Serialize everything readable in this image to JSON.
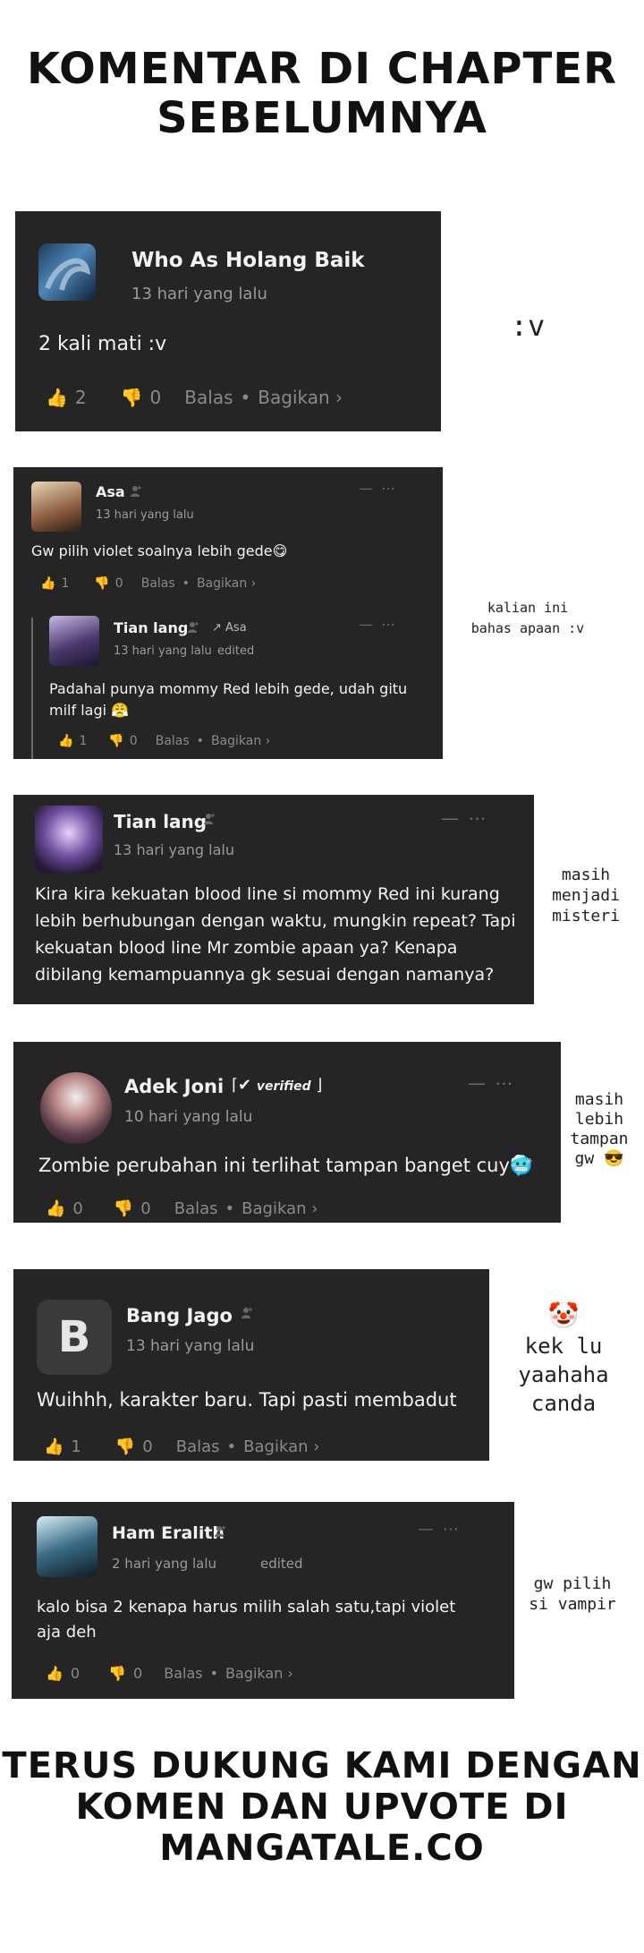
{
  "header": {
    "line1": "KOMENTAR DI CHAPTER",
    "line2": "SEBELUMNYA"
  },
  "footer": {
    "line1": "TERUS DUKUNG KAMI DENGAN",
    "line2": "KOMEN DAN UPVOTE DI",
    "line3": "MANGATALE.CO"
  },
  "labels": {
    "reply": "Balas",
    "share": "Bagikan ›",
    "edited": "edited"
  },
  "comments": [
    {
      "name": "Who As Holang Baik",
      "time": "13 hari yang lalu",
      "text": "2 kali mati :v",
      "likes": "2",
      "dislikes": "0",
      "note": ":v"
    },
    {
      "name": "Asa",
      "time": "13 hari yang lalu",
      "text": "Gw pilih violet soalnya lebih gede😋",
      "likes": "1",
      "dislikes": "0",
      "reply": {
        "name": "Tian lang",
        "reply_to": "Asa",
        "time": "13 hari yang lalu",
        "text": "Padahal punya mommy Red lebih gede, udah gitu milf lagi 😤",
        "likes": "1",
        "dislikes": "0"
      },
      "note": "kalian ini bahas apaan :v"
    },
    {
      "name": "Tian lang",
      "time": "13 hari yang lalu",
      "text": "Kira kira kekuatan blood line si mommy Red ini kurang lebih berhubungan dengan waktu, mungkin repeat? Tapi kekuatan blood line Mr zombie apaan ya? Kenapa dibilang kemampuannya gk sesuai dengan namanya?",
      "note": "masih menjadi misteri"
    },
    {
      "name": "Adek Joni",
      "badge": "verified",
      "time": "10 hari yang lalu",
      "text": "Zombie perubahan ini terlihat tampan banget cuy🥶",
      "likes": "0",
      "dislikes": "0",
      "note": "masih lebih tampan gw 😎"
    },
    {
      "name": "Bang Jago",
      "avatar_letter": "B",
      "time": "13 hari yang lalu",
      "text": "Wuihhh, karakter baru. Tapi pasti membadut",
      "likes": "1",
      "dislikes": "0",
      "note_emoji": "🤡",
      "note": "kek lu yaahaha canda"
    },
    {
      "name": "Ham Eralith",
      "time": "2 hari yang lalu",
      "text": "kalo bisa 2 kenapa harus milih salah satu,tapi violet aja deh",
      "likes": "0",
      "dislikes": "0",
      "note": "gw pilih si vampir"
    }
  ],
  "colors": {
    "card_bg": "#252525",
    "page_bg": "#ffffff",
    "title": "#111111"
  }
}
